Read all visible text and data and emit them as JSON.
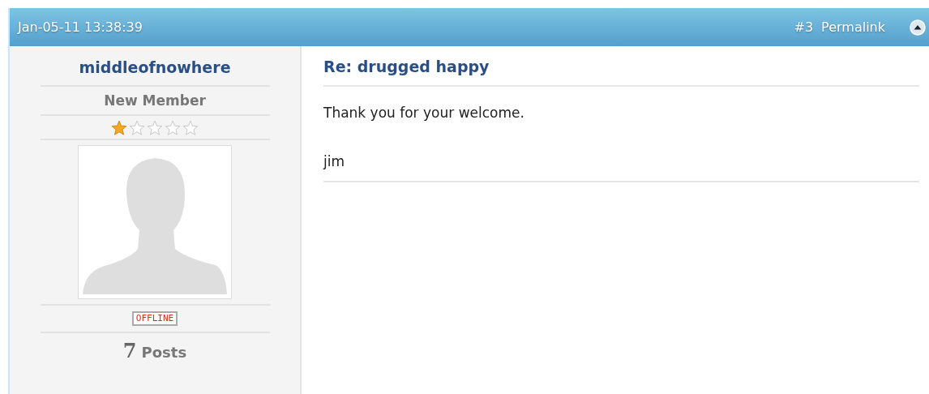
{
  "header": {
    "date": "Jan-05-11 13:38:39",
    "post_number": "#3",
    "permalink": "Permalink"
  },
  "user": {
    "name": "middleofnowhere",
    "title": "New Member",
    "stars": 1,
    "status": "OFFLINE",
    "post_count": "7",
    "post_label": "Posts"
  },
  "post": {
    "title": "Re: drugged happy",
    "paragraphs": [
      "Thank you for your welcome.",
      "jim"
    ]
  }
}
